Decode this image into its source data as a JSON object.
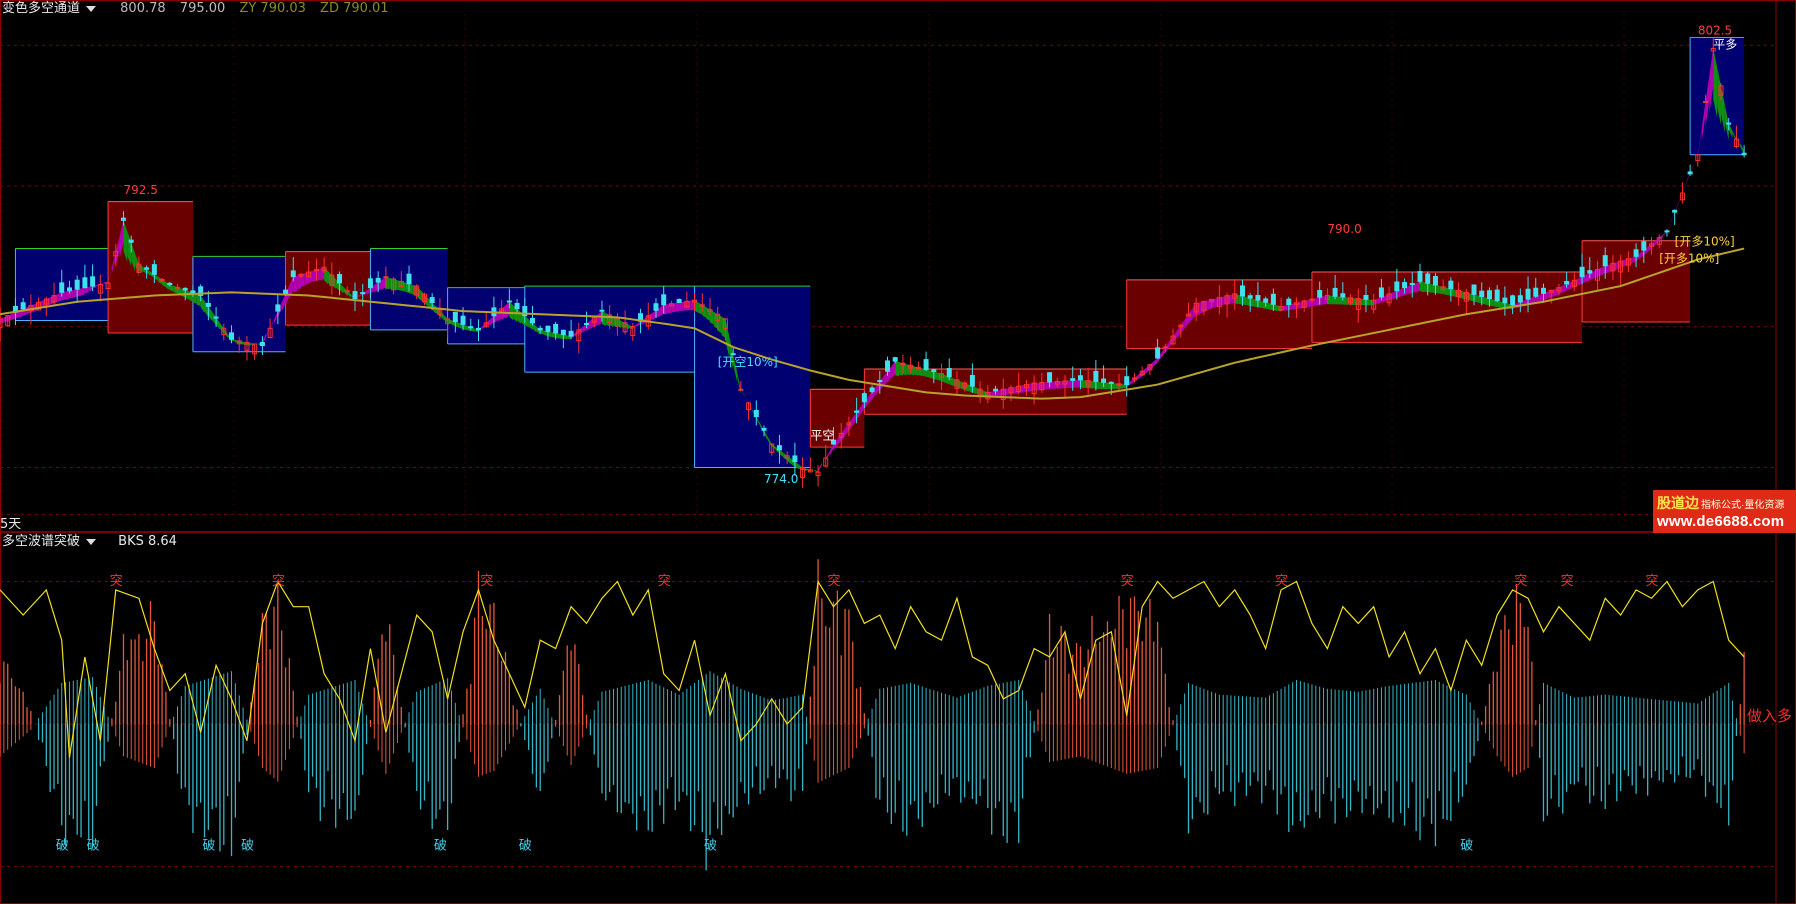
{
  "top_panel": {
    "indicator_name": "变色多空通道",
    "values": [
      "800.78",
      "795.00"
    ],
    "zy": "ZY 790.03",
    "zd": "ZD 790.01",
    "period_label": "5天",
    "colors": {
      "up_candle": "#ff3030",
      "down_candle": "#3ee0ee",
      "bull_band": "#6a0000",
      "bear_band": "#000070",
      "ma_line": "#b8a22a",
      "bull_ribbon": "#b000b0",
      "bear_ribbon": "#109010"
    }
  },
  "bottom_panel": {
    "indicator_name": "多空波谱突破",
    "bks": "BKS 8.64",
    "right_marker": "做入多"
  },
  "watermark": {
    "line1": "股道边",
    "line1_small": "指标公式·量化资源",
    "line2": "www.de6688.com"
  },
  "chart_data": [
    {
      "type": "candlestick",
      "x": {
        "type": "bar-index",
        "range": [
          0,
          230
        ]
      },
      "ylim": [
        771.0,
        804.0
      ],
      "grid": "dotted-horizontal",
      "price_line": [
        [
          0,
          784.5
        ],
        [
          8,
          786.2
        ],
        [
          14,
          786.8
        ],
        [
          16,
          790.8
        ],
        [
          18,
          788.0
        ],
        [
          22,
          786.7
        ],
        [
          26,
          786.0
        ],
        [
          30,
          783.2
        ],
        [
          34,
          782.8
        ],
        [
          38,
          787.2
        ],
        [
          42,
          787.8
        ],
        [
          46,
          785.8
        ],
        [
          50,
          787.2
        ],
        [
          54,
          786.6
        ],
        [
          58,
          784.5
        ],
        [
          62,
          783.8
        ],
        [
          66,
          785.6
        ],
        [
          70,
          783.8
        ],
        [
          74,
          783.4
        ],
        [
          78,
          785.0
        ],
        [
          82,
          784.0
        ],
        [
          86,
          785.4
        ],
        [
          90,
          785.7
        ],
        [
          94,
          784.5
        ],
        [
          96,
          780.0
        ],
        [
          100,
          776.5
        ],
        [
          104,
          775.0
        ],
        [
          106,
          774.7
        ],
        [
          108,
          776.5
        ],
        [
          112,
          779.2
        ],
        [
          116,
          781.8
        ],
        [
          122,
          781.0
        ],
        [
          128,
          779.8
        ],
        [
          134,
          780.4
        ],
        [
          140,
          780.6
        ],
        [
          146,
          780.3
        ],
        [
          150,
          782.0
        ],
        [
          155,
          785.5
        ],
        [
          160,
          786.1
        ],
        [
          166,
          785.3
        ],
        [
          172,
          786.0
        ],
        [
          178,
          785.7
        ],
        [
          184,
          786.9
        ],
        [
          190,
          786.2
        ],
        [
          196,
          785.4
        ],
        [
          202,
          786.5
        ],
        [
          208,
          787.9
        ],
        [
          212,
          788.5
        ],
        [
          216,
          790.1
        ],
        [
          220,
          795.0
        ],
        [
          222,
          801.8
        ],
        [
          224,
          797.0
        ],
        [
          226,
          795.0
        ]
      ],
      "ma_line": [
        [
          0,
          784.8
        ],
        [
          10,
          785.6
        ],
        [
          20,
          786.0
        ],
        [
          30,
          786.2
        ],
        [
          40,
          786.0
        ],
        [
          50,
          785.5
        ],
        [
          60,
          785.0
        ],
        [
          70,
          784.8
        ],
        [
          80,
          784.6
        ],
        [
          86,
          784.2
        ],
        [
          90,
          783.9
        ],
        [
          95,
          782.7
        ],
        [
          100,
          781.9
        ],
        [
          105,
          781.2
        ],
        [
          110,
          780.6
        ],
        [
          115,
          780.2
        ],
        [
          120,
          779.8
        ],
        [
          125,
          779.6
        ],
        [
          130,
          779.5
        ],
        [
          135,
          779.4
        ],
        [
          140,
          779.5
        ],
        [
          145,
          779.9
        ],
        [
          150,
          780.3
        ],
        [
          155,
          781.0
        ],
        [
          160,
          781.7
        ],
        [
          170,
          782.8
        ],
        [
          180,
          783.8
        ],
        [
          190,
          784.8
        ],
        [
          200,
          785.6
        ],
        [
          210,
          786.6
        ],
        [
          220,
          788.3
        ],
        [
          226,
          789.0
        ]
      ],
      "band_segments": [
        {
          "x0": 2,
          "x1": 14,
          "top": 789.0,
          "bottom": 784.4,
          "trend": "bear"
        },
        {
          "x0": 14,
          "x1": 25,
          "top": 792.0,
          "bottom": 783.6,
          "trend": "bull"
        },
        {
          "x0": 25,
          "x1": 37,
          "top": 788.5,
          "bottom": 782.4,
          "trend": "bear"
        },
        {
          "x0": 37,
          "x1": 48,
          "top": 788.8,
          "bottom": 784.1,
          "trend": "bull"
        },
        {
          "x0": 48,
          "x1": 58,
          "top": 789.0,
          "bottom": 783.8,
          "trend": "bear"
        },
        {
          "x0": 58,
          "x1": 68,
          "top": 786.5,
          "bottom": 782.9,
          "trend": "bear"
        },
        {
          "x0": 68,
          "x1": 90,
          "top": 786.6,
          "bottom": 781.1,
          "trend": "bear"
        },
        {
          "x0": 90,
          "x1": 105,
          "top": 786.6,
          "bottom": 775.0,
          "trend": "bear"
        },
        {
          "x0": 105,
          "x1": 112,
          "top": 780.0,
          "bottom": 776.3,
          "trend": "bull"
        },
        {
          "x0": 112,
          "x1": 146,
          "top": 781.3,
          "bottom": 778.4,
          "trend": "bull"
        },
        {
          "x0": 146,
          "x1": 170,
          "top": 787.0,
          "bottom": 782.6,
          "trend": "bull"
        },
        {
          "x0": 170,
          "x1": 205,
          "top": 787.5,
          "bottom": 783.0,
          "trend": "bull"
        },
        {
          "x0": 205,
          "x1": 219,
          "top": 789.5,
          "bottom": 784.3,
          "trend": "bull"
        },
        {
          "x0": 219,
          "x1": 226,
          "top": 802.5,
          "bottom": 795.0,
          "trend": "bear"
        }
      ],
      "annotations": [
        {
          "x": 16,
          "y": 792.5,
          "text": "792.5",
          "color": "#ff3b3b"
        },
        {
          "x": 93,
          "y": 781.5,
          "text": "[开空10%]",
          "color": "#40e0ff"
        },
        {
          "x": 105,
          "y": 776.8,
          "text": "平空",
          "color": "#ffffff"
        },
        {
          "x": 99,
          "y": 774.0,
          "text": "774.0",
          "color": "#40e0ff"
        },
        {
          "x": 172,
          "y": 790.0,
          "text": "790.0",
          "color": "#ff3b3b"
        },
        {
          "x": 220,
          "y": 802.7,
          "text": "802.5",
          "color": "#ff3b3b"
        },
        {
          "x": 222,
          "y": 801.8,
          "text": "平多",
          "color": "#ffffff"
        },
        {
          "x": 217,
          "y": 789.2,
          "text": "[开多10%]",
          "color": "#ffd040"
        },
        {
          "x": 215,
          "y": 788.1,
          "text": "[开多10%]",
          "color": "#ffd040"
        }
      ]
    },
    {
      "type": "bar",
      "ylim": [
        -10.5,
        10.5
      ],
      "x": {
        "type": "bar-index",
        "range": [
          0,
          230
        ]
      },
      "hist_envelope": [
        [
          0,
          5.5
        ],
        [
          4,
          1.0
        ],
        [
          8,
          -7.0
        ],
        [
          12,
          -8.0
        ],
        [
          16,
          5.5
        ],
        [
          20,
          7.5
        ],
        [
          24,
          -6.5
        ],
        [
          30,
          -9.0
        ],
        [
          34,
          7.5
        ],
        [
          36,
          9.8
        ],
        [
          40,
          -5.0
        ],
        [
          46,
          -7.5
        ],
        [
          50,
          8.5
        ],
        [
          54,
          -5.5
        ],
        [
          58,
          -7.8
        ],
        [
          62,
          9.0
        ],
        [
          64,
          8.0
        ],
        [
          70,
          -6.0
        ],
        [
          74,
          7.0
        ],
        [
          78,
          -5.5
        ],
        [
          84,
          -7.5
        ],
        [
          88,
          -5.0
        ],
        [
          92,
          -9.0
        ],
        [
          96,
          -6.0
        ],
        [
          100,
          -4.0
        ],
        [
          104,
          -5.0
        ],
        [
          106,
          10.0
        ],
        [
          110,
          7.5
        ],
        [
          114,
          -6.0
        ],
        [
          118,
          -7.0
        ],
        [
          124,
          -4.5
        ],
        [
          128,
          -6.5
        ],
        [
          132,
          -7.5
        ],
        [
          136,
          6.5
        ],
        [
          140,
          5.5
        ],
        [
          146,
          8.5
        ],
        [
          150,
          7.5
        ],
        [
          154,
          -7.0
        ],
        [
          158,
          -5.0
        ],
        [
          164,
          -4.5
        ],
        [
          168,
          -7.5
        ],
        [
          172,
          -6.0
        ],
        [
          176,
          -5.5
        ],
        [
          180,
          -6.5
        ],
        [
          186,
          -7.5
        ],
        [
          190,
          -5.0
        ],
        [
          194,
          5.5
        ],
        [
          196,
          9.0
        ],
        [
          198,
          7.5
        ],
        [
          200,
          -7.0
        ],
        [
          204,
          -4.5
        ],
        [
          208,
          -5.0
        ],
        [
          212,
          -4.5
        ],
        [
          216,
          -4.0
        ],
        [
          220,
          -3.5
        ],
        [
          224,
          -7.0
        ],
        [
          226,
          5.0
        ]
      ],
      "signal_line": [
        [
          0,
          8.0
        ],
        [
          3,
          6.5
        ],
        [
          6,
          8.0
        ],
        [
          8,
          5.0
        ],
        [
          9,
          -2.0
        ],
        [
          11,
          4.0
        ],
        [
          13,
          -1.0
        ],
        [
          15,
          8.0
        ],
        [
          18,
          7.5
        ],
        [
          20,
          4.5
        ],
        [
          22,
          2.0
        ],
        [
          24,
          3.0
        ],
        [
          26,
          -0.5
        ],
        [
          28,
          3.5
        ],
        [
          30,
          1.5
        ],
        [
          32,
          -1.0
        ],
        [
          34,
          6.0
        ],
        [
          36,
          8.5
        ],
        [
          38,
          7.0
        ],
        [
          40,
          7.0
        ],
        [
          42,
          3.0
        ],
        [
          44,
          1.5
        ],
        [
          46,
          -1.0
        ],
        [
          48,
          4.5
        ],
        [
          50,
          -0.5
        ],
        [
          52,
          3.0
        ],
        [
          54,
          6.5
        ],
        [
          56,
          5.5
        ],
        [
          58,
          1.5
        ],
        [
          60,
          5.5
        ],
        [
          62,
          8.0
        ],
        [
          64,
          5.0
        ],
        [
          66,
          3.0
        ],
        [
          68,
          1.0
        ],
        [
          70,
          5.0
        ],
        [
          72,
          4.5
        ],
        [
          74,
          7.0
        ],
        [
          76,
          6.0
        ],
        [
          78,
          7.5
        ],
        [
          80,
          8.5
        ],
        [
          82,
          6.5
        ],
        [
          84,
          8.0
        ],
        [
          86,
          3.0
        ],
        [
          88,
          2.0
        ],
        [
          90,
          5.0
        ],
        [
          92,
          0.5
        ],
        [
          94,
          3.0
        ],
        [
          96,
          -1.0
        ],
        [
          98,
          0.0
        ],
        [
          100,
          1.5
        ],
        [
          102,
          0.0
        ],
        [
          104,
          1.0
        ],
        [
          106,
          8.5
        ],
        [
          108,
          7.0
        ],
        [
          110,
          8.0
        ],
        [
          112,
          6.0
        ],
        [
          114,
          6.5
        ],
        [
          116,
          4.5
        ],
        [
          118,
          7.0
        ],
        [
          120,
          5.5
        ],
        [
          122,
          5.0
        ],
        [
          124,
          7.5
        ],
        [
          126,
          4.0
        ],
        [
          128,
          3.5
        ],
        [
          130,
          1.5
        ],
        [
          132,
          2.0
        ],
        [
          134,
          4.5
        ],
        [
          136,
          4.0
        ],
        [
          138,
          5.5
        ],
        [
          140,
          1.5
        ],
        [
          142,
          5.0
        ],
        [
          144,
          5.5
        ],
        [
          146,
          0.5
        ],
        [
          148,
          7.0
        ],
        [
          150,
          8.5
        ],
        [
          152,
          7.5
        ],
        [
          154,
          8.0
        ],
        [
          156,
          8.5
        ],
        [
          158,
          7.0
        ],
        [
          160,
          8.0
        ],
        [
          162,
          6.5
        ],
        [
          164,
          4.5
        ],
        [
          166,
          8.0
        ],
        [
          168,
          8.5
        ],
        [
          170,
          6.0
        ],
        [
          172,
          4.5
        ],
        [
          174,
          7.0
        ],
        [
          176,
          6.0
        ],
        [
          178,
          7.0
        ],
        [
          180,
          4.0
        ],
        [
          182,
          5.5
        ],
        [
          184,
          3.0
        ],
        [
          186,
          4.5
        ],
        [
          188,
          2.0
        ],
        [
          190,
          5.0
        ],
        [
          192,
          3.5
        ],
        [
          194,
          6.5
        ],
        [
          196,
          8.0
        ],
        [
          198,
          7.5
        ],
        [
          200,
          5.5
        ],
        [
          202,
          7.0
        ],
        [
          204,
          6.0
        ],
        [
          206,
          5.0
        ],
        [
          208,
          7.5
        ],
        [
          210,
          6.5
        ],
        [
          212,
          8.0
        ],
        [
          214,
          7.5
        ],
        [
          216,
          8.5
        ],
        [
          218,
          7.0
        ],
        [
          220,
          8.0
        ],
        [
          222,
          8.5
        ],
        [
          224,
          5.0
        ],
        [
          226,
          4.0
        ]
      ],
      "signals": [
        {
          "x": 15,
          "text": "突",
          "kind": "up"
        },
        {
          "x": 36,
          "text": "突",
          "kind": "up"
        },
        {
          "x": 63,
          "text": "突",
          "kind": "up"
        },
        {
          "x": 86,
          "text": "突",
          "kind": "up"
        },
        {
          "x": 108,
          "text": "突",
          "kind": "up"
        },
        {
          "x": 146,
          "text": "突",
          "kind": "up"
        },
        {
          "x": 166,
          "text": "突",
          "kind": "up"
        },
        {
          "x": 197,
          "text": "突",
          "kind": "up"
        },
        {
          "x": 203,
          "text": "突",
          "kind": "up"
        },
        {
          "x": 214,
          "text": "突",
          "kind": "up"
        },
        {
          "x": 8,
          "text": "破",
          "kind": "down"
        },
        {
          "x": 12,
          "text": "破",
          "kind": "down"
        },
        {
          "x": 27,
          "text": "破",
          "kind": "down"
        },
        {
          "x": 32,
          "text": "破",
          "kind": "down"
        },
        {
          "x": 57,
          "text": "破",
          "kind": "down"
        },
        {
          "x": 68,
          "text": "破",
          "kind": "down"
        },
        {
          "x": 92,
          "text": "破",
          "kind": "down"
        },
        {
          "x": 190,
          "text": "破",
          "kind": "down"
        }
      ]
    }
  ]
}
